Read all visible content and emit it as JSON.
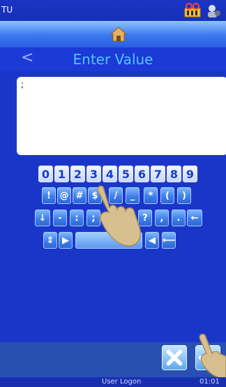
{
  "status": {
    "device": "TU"
  },
  "title": {
    "text": "Enter Value",
    "back_glyph": "<"
  },
  "value_box": {
    "text": ";"
  },
  "keyboard": {
    "digits": [
      "0",
      "1",
      "2",
      "3",
      "4",
      "5",
      "6",
      "7",
      "8",
      "9"
    ],
    "row2": [
      "!",
      "@",
      "#",
      "$",
      "/",
      "_",
      "*",
      "(",
      ")"
    ],
    "row3": [
      "↓",
      "-",
      ":",
      ";",
      "?",
      ",",
      ".",
      "←"
    ],
    "row4": [
      "⇕",
      "▶",
      "",
      "◀",
      "⟵"
    ]
  },
  "footer": {
    "logon": "User Logon",
    "clock": "01:01"
  },
  "colors": {
    "background": "#1a36c9",
    "title": "#55c4ff"
  }
}
